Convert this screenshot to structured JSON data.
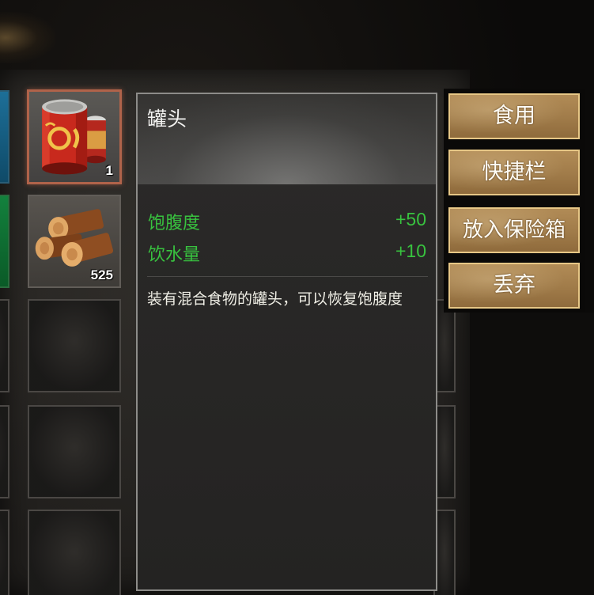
{
  "item": {
    "name": "罐头",
    "stats": [
      {
        "label": "饱腹度",
        "value": "+50"
      },
      {
        "label": "饮水量",
        "value": "+10"
      }
    ],
    "description": "装有混合食物的罐头，可以恢复饱腹度"
  },
  "slots": {
    "selected_count": "1",
    "wood_count": "525",
    "selected_icon": "canned-food-icon",
    "wood_icon": "wood-logs-icon"
  },
  "actions": {
    "eat": "食用",
    "hotbar": "快捷栏",
    "to_safe": "放入保险箱",
    "discard": "丢弃"
  },
  "colors": {
    "stat_green": "#38c23f",
    "selected_border": "#b0634a",
    "button_gold": "#a07b49"
  }
}
